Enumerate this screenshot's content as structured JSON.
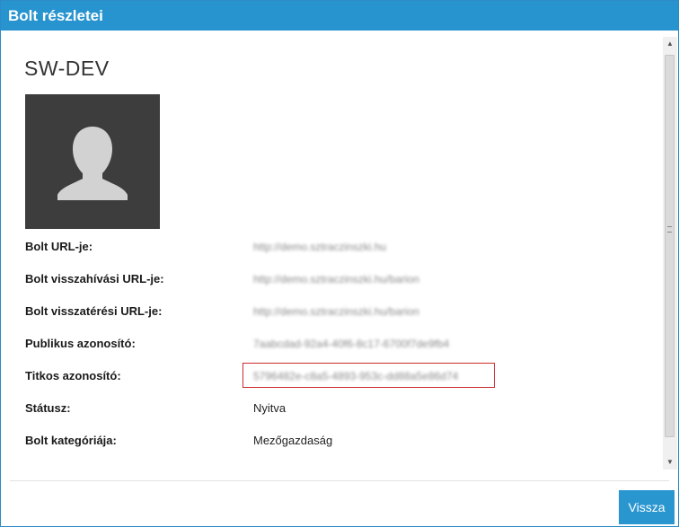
{
  "dialog": {
    "title": "Bolt részletei",
    "shop_name": "SW-DEV",
    "avatar_icon": "user-silhouette-icon",
    "fields": [
      {
        "label": "Bolt URL-je:",
        "value": "http://demo.sztraczinszki.hu",
        "blurred": true
      },
      {
        "label": "Bolt visszahívási URL-je:",
        "value": "http://demo.sztraczinszki.hu/barion",
        "blurred": true
      },
      {
        "label": "Bolt visszatérési URL-je:",
        "value": "http://demo.sztraczinszki.hu/barion",
        "blurred": true
      },
      {
        "label": "Publikus azonosító:",
        "value": "7aabcdad-92a4-40f6-8c17-6700f7de9fb4",
        "blurred": true
      },
      {
        "label": "Titkos azonosító:",
        "value": "5796482e-c8a5-4893-953c-dd88a5e86d74",
        "blurred": true
      },
      {
        "label": "Státusz:",
        "value": "Nyitva",
        "blurred": false
      },
      {
        "label": "Bolt kategóriája:",
        "value": "Mezőgazdaság",
        "blurred": false
      }
    ],
    "back_label": "Vissza"
  },
  "colors": {
    "titlebar": "#2894cf",
    "button": "#2a96d0",
    "avatar_bg": "#3d3d3d",
    "highlight_border": "#cc2a2a"
  }
}
